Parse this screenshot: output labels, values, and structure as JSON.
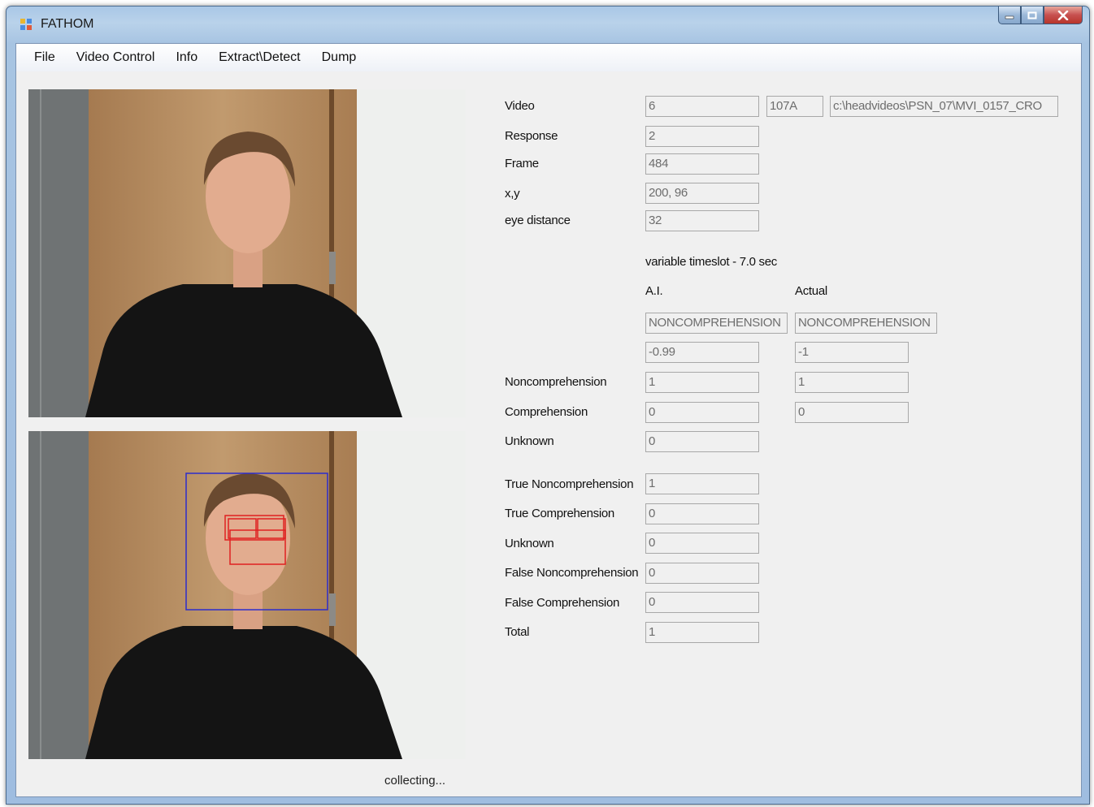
{
  "window": {
    "title": "FATHOM"
  },
  "menu": [
    "File",
    "Video Control",
    "Info",
    "Extract\\Detect",
    "Dump"
  ],
  "status": "collecting...",
  "fields": {
    "video_label": "Video",
    "video_number": "6",
    "video_id": "107A",
    "video_path": "c:\\headvideos\\PSN_07\\MVI_0157_CRO",
    "response_label": "Response",
    "response": "2",
    "frame_label": "Frame",
    "frame": "484",
    "xy_label": "x,y",
    "xy": "200, 96",
    "eye_distance_label": "eye distance",
    "eye_distance": "32"
  },
  "timeslot": "variable timeslot - 7.0 sec",
  "columns": {
    "ai": "A.I.",
    "actual": "Actual"
  },
  "classification": {
    "ai_state": "NONCOMPREHENSION",
    "actual_state": "NONCOMPREHENSION",
    "ai_score": "-0.99",
    "actual_score": "-1"
  },
  "counts": {
    "noncomprehension_label": "Noncomprehension",
    "noncomprehension_ai": "1",
    "noncomprehension_actual": "1",
    "comprehension_label": "Comprehension",
    "comprehension_ai": "0",
    "comprehension_actual": "0",
    "unknown_label": "Unknown",
    "unknown_ai": "0"
  },
  "totals": {
    "true_noncomprehension_label": "True Noncomprehension",
    "true_noncomprehension": "1",
    "true_comprehension_label": "True Comprehension",
    "true_comprehension": "0",
    "unknown_label": "Unknown",
    "unknown": "0",
    "false_noncomprehension_label": "False Noncomprehension",
    "false_noncomprehension": "0",
    "false_comprehension_label": "False Comprehension",
    "false_comprehension": "0",
    "total_label": "Total",
    "total": "1"
  }
}
